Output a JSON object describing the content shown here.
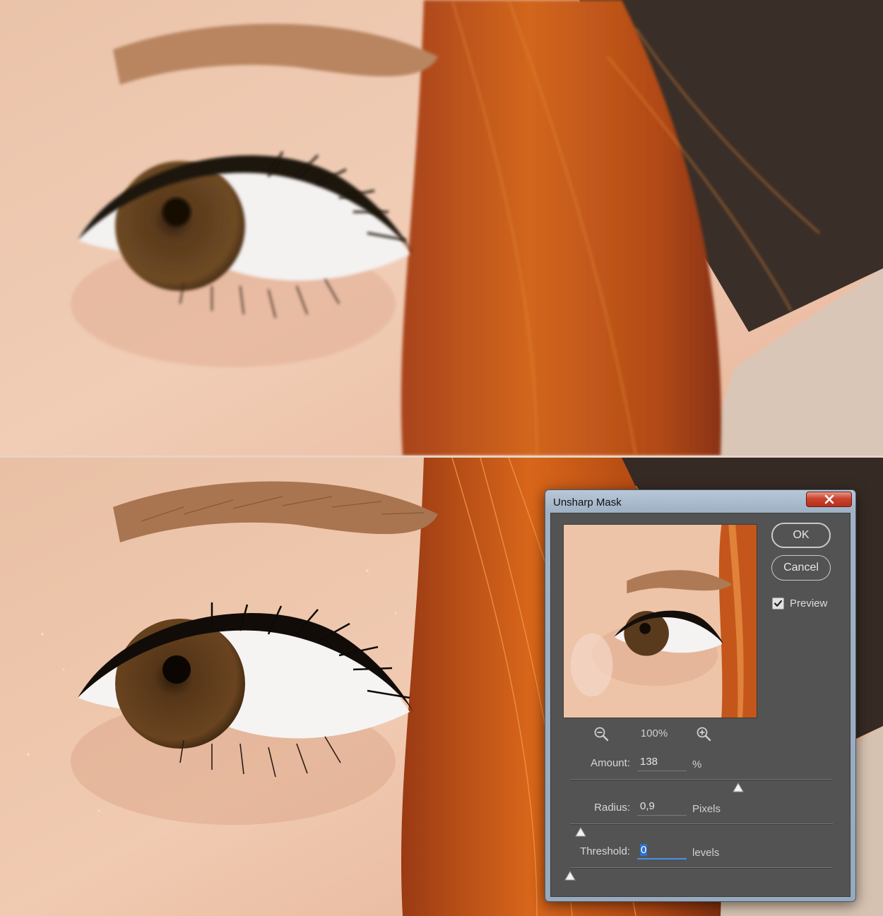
{
  "dialog": {
    "title": "Unsharp Mask",
    "ok_label": "OK",
    "cancel_label": "Cancel",
    "preview_label": "Preview",
    "preview_checked": true,
    "zoom_level": "100%",
    "params": [
      {
        "label": "Amount:",
        "value": "138",
        "unit": "%",
        "slider_fraction": 0.64
      },
      {
        "label": "Radius:",
        "value": "0,9",
        "unit": "Pixels",
        "slider_fraction": 0.04
      },
      {
        "label": "Threshold:",
        "value": "0",
        "unit": "levels",
        "slider_fraction": 0.0
      }
    ]
  },
  "colors": {
    "dialog_body": "#535353",
    "close_button": "#c9442f",
    "skin": "#f0c8ae",
    "hair": "#c8561c",
    "iris": "#5a3a1c"
  },
  "icons": [
    "close-icon",
    "zoom-out-icon",
    "zoom-in-icon",
    "checkmark-icon",
    "slider-thumb-icon"
  ]
}
